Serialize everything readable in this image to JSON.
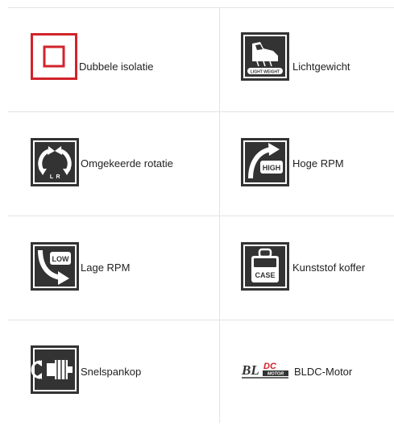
{
  "features": [
    {
      "label": "Dubbele isolatie",
      "icon": "double-insulation-icon"
    },
    {
      "label": "Lichtgewicht",
      "icon": "lightweight-icon",
      "badge": "LIGHT WEIGHT"
    },
    {
      "label": "Omgekeerde rotatie",
      "icon": "reverse-rotation-icon",
      "marks": [
        "L",
        "R"
      ]
    },
    {
      "label": "Hoge RPM",
      "icon": "high-rpm-icon",
      "badge": "HIGH"
    },
    {
      "label": "Lage RPM",
      "icon": "low-rpm-icon",
      "badge": "LOW"
    },
    {
      "label": "Kunststof koffer",
      "icon": "plastic-case-icon",
      "badge": "CASE"
    },
    {
      "label": "Snelspankop",
      "icon": "quick-chuck-icon"
    },
    {
      "label": "BLDC-Motor",
      "icon": "bldc-motor-icon",
      "badge": "BL",
      "badge_sub": "DC",
      "badge_small": "MOTOR"
    }
  ],
  "colors": {
    "insulation_red": "#d2232a",
    "icon_dark": "#333333",
    "divider": "#e3e3e3"
  }
}
